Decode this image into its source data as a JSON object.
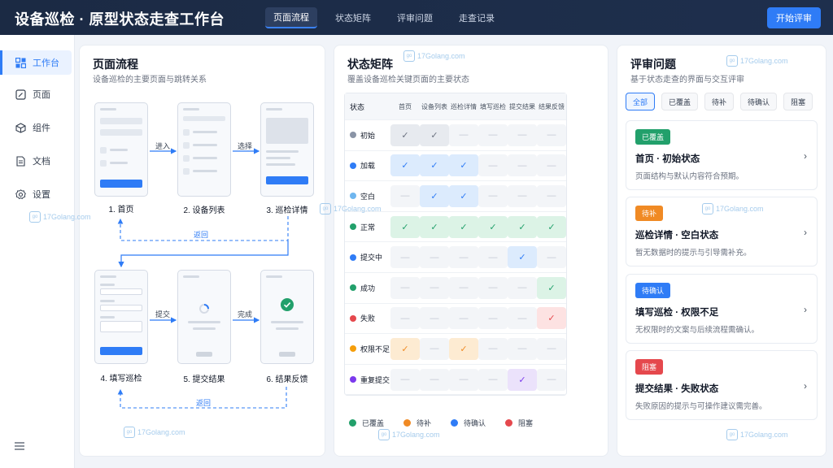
{
  "header": {
    "title": "设备巡检 · 原型状态走查工作台",
    "nav": [
      "页面流程",
      "状态矩阵",
      "评审问题",
      "走查记录"
    ],
    "start_button": "开始评审"
  },
  "sidebar": {
    "items": [
      {
        "label": "工作台",
        "icon": "dashboard-icon"
      },
      {
        "label": "页面",
        "icon": "edit-icon"
      },
      {
        "label": "组件",
        "icon": "cube-icon"
      },
      {
        "label": "文档",
        "icon": "document-icon"
      },
      {
        "label": "设置",
        "icon": "gear-icon"
      }
    ]
  },
  "flow": {
    "title": "页面流程",
    "subtitle": "设备巡检的主要页面与跳转关系",
    "steps": [
      "1. 首页",
      "2. 设备列表",
      "3. 巡检详情",
      "4. 填写巡检",
      "5. 提交结果",
      "6. 结果反馈"
    ],
    "arrows": [
      "进入",
      "选择",
      "提交",
      "完成"
    ],
    "back1": "返回",
    "back2": "返回"
  },
  "matrix": {
    "title": "状态矩阵",
    "subtitle": "覆盖设备巡检关键页面的主要状态",
    "header_state": "状态",
    "columns": [
      "首页",
      "设备列表",
      "巡检详情",
      "填写巡检",
      "提交结果",
      "结果反馈"
    ],
    "rows": [
      {
        "label": "初始",
        "dot": "#8a94a6",
        "cells": [
          "g",
          "g",
          "-",
          "-",
          "-",
          "-"
        ]
      },
      {
        "label": "加载",
        "dot": "#2f7cf6",
        "cells": [
          "b",
          "b",
          "b",
          "-",
          "-",
          "-"
        ]
      },
      {
        "label": "空白",
        "dot": "#6fb6ef",
        "cells": [
          "-",
          "b",
          "b",
          "-",
          "-",
          "-"
        ]
      },
      {
        "label": "正常",
        "dot": "#22a06b",
        "cells": [
          "c",
          "c",
          "c",
          "c",
          "c",
          "c"
        ]
      },
      {
        "label": "提交中",
        "dot": "#2f7cf6",
        "cells": [
          "-",
          "-",
          "-",
          "-",
          "b",
          "-"
        ]
      },
      {
        "label": "成功",
        "dot": "#22a06b",
        "cells": [
          "-",
          "-",
          "-",
          "-",
          "-",
          "c"
        ]
      },
      {
        "label": "失败",
        "dot": "#e5484d",
        "cells": [
          "-",
          "-",
          "-",
          "-",
          "-",
          "r"
        ]
      },
      {
        "label": "权限不足",
        "dot": "#f59e0b",
        "cells": [
          "o",
          "-",
          "o",
          "-",
          "-",
          "-"
        ]
      },
      {
        "label": "重复提交",
        "dot": "#7c3aed",
        "cells": [
          "-",
          "-",
          "-",
          "-",
          "p",
          "-"
        ]
      }
    ],
    "legend": [
      {
        "label": "已覆盖",
        "color": "#22a06b"
      },
      {
        "label": "待补",
        "color": "#f08a24"
      },
      {
        "label": "待确认",
        "color": "#2f7cf6"
      },
      {
        "label": "阻塞",
        "color": "#e5484d"
      }
    ]
  },
  "review": {
    "title": "评审问题",
    "subtitle": "基于状态走查的界面与交互评审",
    "filters": [
      "全部",
      "已覆盖",
      "待补",
      "待确认",
      "阻塞"
    ],
    "cards": [
      {
        "badge": "已覆盖",
        "color": "#22a06b",
        "title": "首页 · 初始状态",
        "desc": "页面结构与默认内容符合预期。"
      },
      {
        "badge": "待补",
        "color": "#f08a24",
        "title": "巡检详情 · 空白状态",
        "desc": "暂无数据时的提示与引导需补充。"
      },
      {
        "badge": "待确认",
        "color": "#2f7cf6",
        "title": "填写巡检 · 权限不足",
        "desc": "无权限时的文案与后续流程需确认。"
      },
      {
        "badge": "阻塞",
        "color": "#e5484d",
        "title": "提交结果 · 失败状态",
        "desc": "失败原因的提示与可操作建议需完善。"
      }
    ]
  },
  "watermark": "17Golang.com"
}
